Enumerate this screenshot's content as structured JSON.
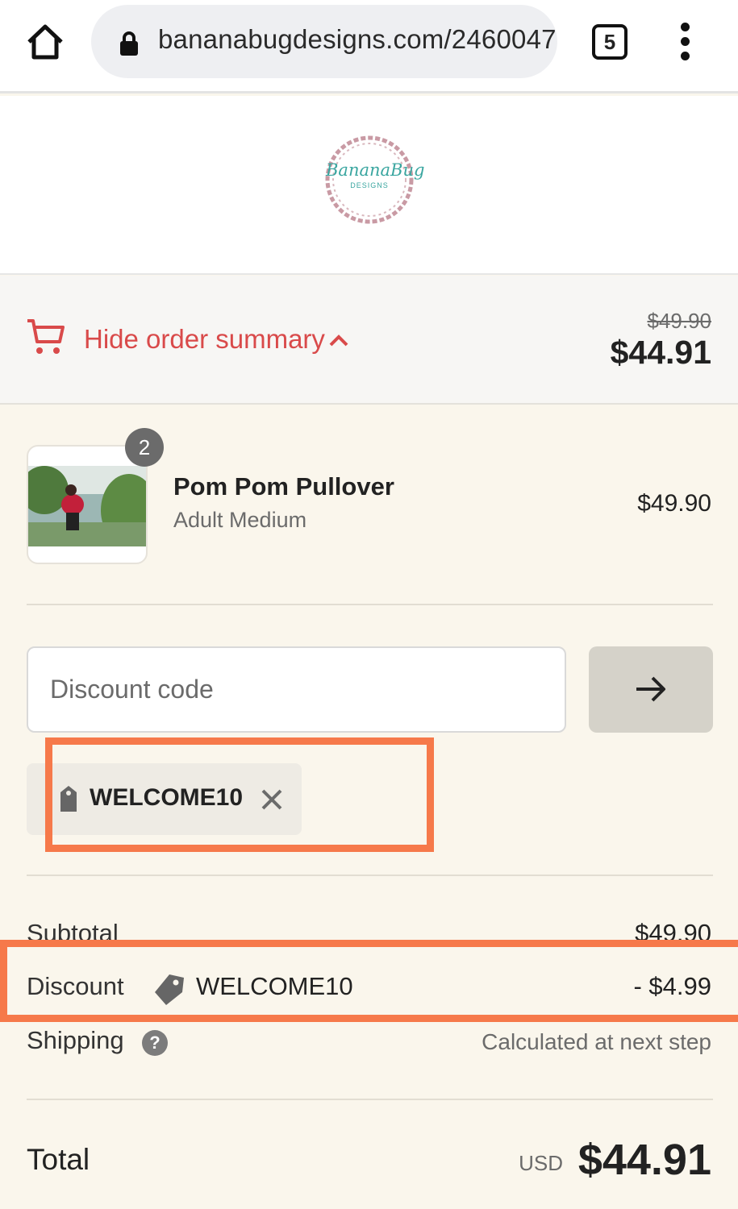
{
  "browser": {
    "url": "bananabugdesigns.com/2460047",
    "tab_count": "5"
  },
  "logo": {
    "alt": "Banana Bug Designs",
    "script_text": "BananaBug",
    "sub_text": "DESIGNS"
  },
  "summary": {
    "toggle_label": "Hide order summary",
    "original_price": "$49.90",
    "total_price": "$44.91"
  },
  "product": {
    "quantity": "2",
    "name": "Pom Pom Pullover",
    "variant": "Adult Medium",
    "price": "$49.90"
  },
  "discount": {
    "placeholder": "Discount code",
    "applied_code": "WELCOME10"
  },
  "totals": {
    "subtotal_label": "Subtotal",
    "subtotal_value": "$49.90",
    "discount_label": "Discount",
    "discount_code": "WELCOME10",
    "discount_value": "- $4.99",
    "shipping_label": "Shipping",
    "shipping_help": "?",
    "shipping_value": "Calculated at next step",
    "total_label": "Total",
    "currency": "USD",
    "total_value": "$44.91"
  },
  "colors": {
    "accent": "#d94a4a",
    "highlight": "#f6794a",
    "background": "#faf6ec"
  },
  "icons": [
    "home-icon",
    "lock-icon",
    "tabs-icon",
    "more-vert-icon",
    "cart-icon",
    "chevron-up-icon",
    "arrow-right-icon",
    "tag-icon",
    "close-icon",
    "help-icon"
  ]
}
